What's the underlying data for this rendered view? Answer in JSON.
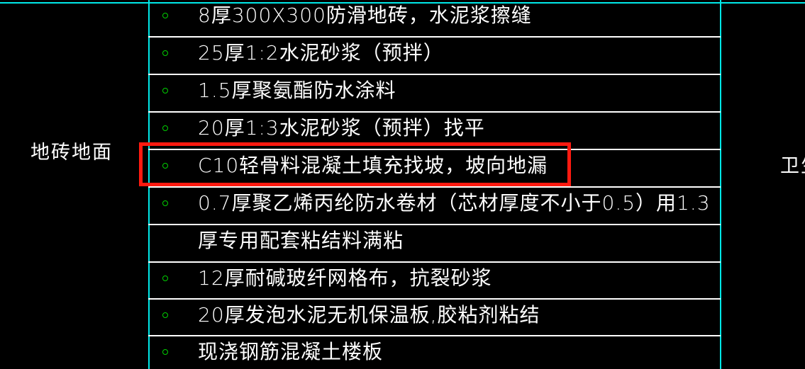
{
  "drawing": {
    "background_color": "#000000",
    "line_color": "#ffffff",
    "guide_color": "#00e8e8",
    "marker_color": "#00d000",
    "highlight_color": "#ff1a10",
    "left_label": "地砖地面",
    "right_label": "卫生"
  },
  "layers": [
    {
      "index": 1,
      "text": "8厚300X300防滑地砖，水泥浆擦缝",
      "marker": true,
      "continuation": false
    },
    {
      "index": 2,
      "text": "25厚1:2水泥砂浆（预拌）",
      "marker": true,
      "continuation": false
    },
    {
      "index": 3,
      "text": "1.5厚聚氨酯防水涂料",
      "marker": true,
      "continuation": false
    },
    {
      "index": 4,
      "text": "20厚1:3水泥砂浆（预拌）找平",
      "marker": true,
      "continuation": false
    },
    {
      "index": 5,
      "text": "C10轻骨料混凝土填充找坡，坡向地漏",
      "marker": true,
      "continuation": false,
      "highlighted": true
    },
    {
      "index": 6,
      "text": "0.7厚聚乙烯丙纶防水卷材（芯材厚度不小于0.5）用1.3",
      "marker": true,
      "continuation": false
    },
    {
      "index": 7,
      "text": "厚专用配套粘结料满粘",
      "marker": false,
      "continuation": true
    },
    {
      "index": 8,
      "text": "12厚耐碱玻纤网格布，抗裂砂浆",
      "marker": true,
      "continuation": false
    },
    {
      "index": 9,
      "text": "20厚发泡水泥无机保温板,胶粘剂粘结",
      "marker": true,
      "continuation": false
    },
    {
      "index": 10,
      "text": "现浇钢筋混凝土楼板",
      "marker": true,
      "continuation": false
    }
  ]
}
